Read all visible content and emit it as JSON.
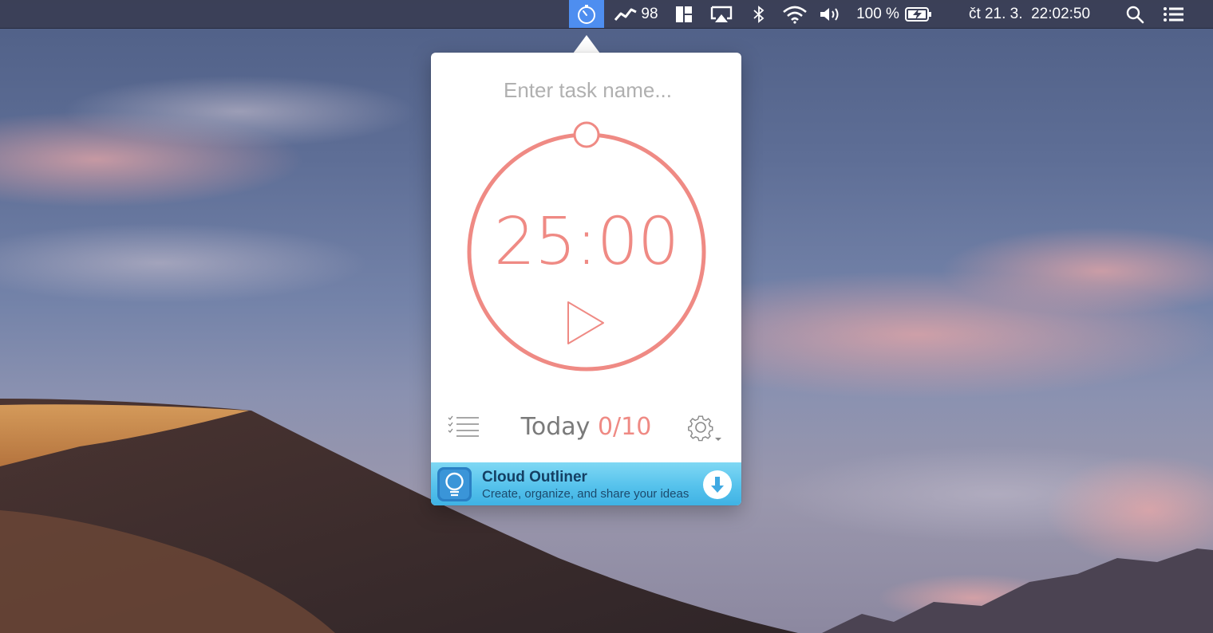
{
  "menubar": {
    "stat_value": "98",
    "battery_percent": "100 %",
    "datetime": "čt 21. 3.  22:02:50",
    "icons": [
      "pomodoro-timer-icon",
      "stats-graph-icon",
      "layout-icon",
      "airplay-icon",
      "bluetooth-icon",
      "wifi-icon",
      "volume-icon",
      "battery-charging-icon",
      "spotlight-search-icon",
      "notification-center-icon"
    ],
    "active_highlight_color": "#4e8ef0"
  },
  "popover": {
    "task_placeholder": "Enter task name...",
    "timer": {
      "display": "25:00",
      "progress_fraction": 0,
      "accent_color": "#ef8a84"
    },
    "today_label": "Today",
    "today_count": "0/10",
    "icons": [
      "task-list-icon",
      "play-icon",
      "gear-icon",
      "dropdown-caret-icon"
    ]
  },
  "ad": {
    "title": "Cloud Outliner",
    "subtitle": "Create, organize, and share your ideas",
    "icons": [
      "lightbulb-app-icon",
      "download-arrow-icon"
    ]
  }
}
